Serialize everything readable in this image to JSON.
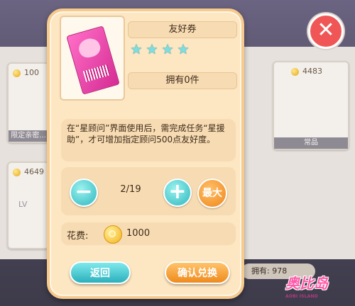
{
  "background": {
    "cards": [
      {
        "value": "100",
        "label": "限定亲密..."
      },
      {
        "value": "4483",
        "label": "常品"
      },
      {
        "value": "4649",
        "label": "LV"
      }
    ],
    "close_glyph": "✕",
    "owned_label": "拥有: 978",
    "logo": {
      "title": "奥比岛",
      "subtitle": "AOBI ISLAND"
    }
  },
  "item": {
    "name": "友好券",
    "stars": 4,
    "star_glyph": "★",
    "owned": "拥有0件",
    "description": "在“星顾问”界面使用后，需完成任务“星援助”，才可增加指定顾问500点友好度。"
  },
  "stepper": {
    "minus": "−",
    "plus": "+",
    "quantity": "2/19",
    "max_label": "最大"
  },
  "cost": {
    "label": "花费:",
    "value": "1000"
  },
  "buttons": {
    "back": "返回",
    "confirm": "确认兑换"
  },
  "colors": {
    "dialog_bg": "#fde6c2",
    "teal_button": "#2db7bf",
    "orange_button": "#f08618",
    "close_red": "#f05656"
  },
  "icons": [
    "close-icon",
    "coin-icon",
    "star-icon",
    "ticket-icon"
  ]
}
